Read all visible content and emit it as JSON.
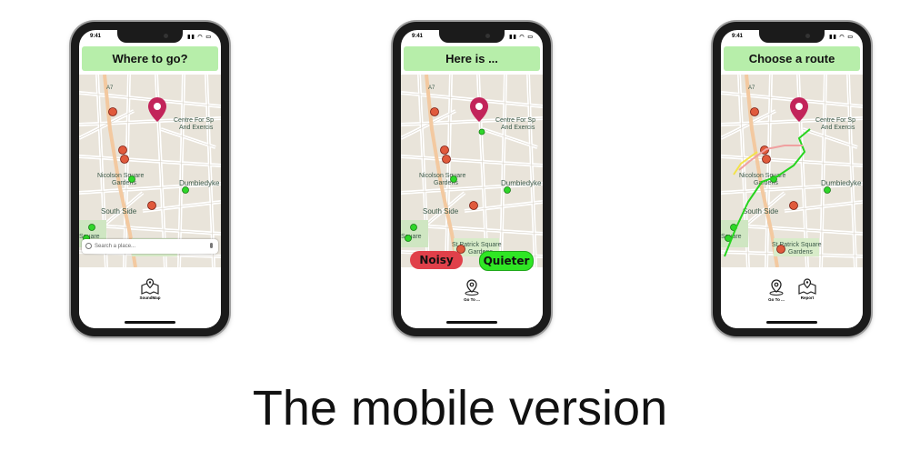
{
  "status": {
    "time": "9:41",
    "signal": "▮▮ ◠ ▭"
  },
  "phones": [
    {
      "title": "Where to go?",
      "search_placeholder": "Search a place...",
      "nav": [
        {
          "label": "SoundMap",
          "icon": "map-pin-icon"
        }
      ]
    },
    {
      "title": "Here is ...",
      "buttons": {
        "noisy": "Noisy",
        "quieter": "Quieter"
      },
      "nav": [
        {
          "label": "Go To ...",
          "icon": "location-pin-icon"
        }
      ]
    },
    {
      "title": "Choose a route",
      "nav": [
        {
          "label": "Go To ...",
          "icon": "location-pin-icon"
        },
        {
          "label": "Report",
          "icon": "map-pin-icon"
        }
      ]
    }
  ],
  "map_labels": {
    "centre": "Centre For Sp",
    "centre2": "And Exercis",
    "nicolson": "Nicolson Square",
    "gardens": "Gardens",
    "dumbiedykes": "Dumbiedyke",
    "southside": "South Side",
    "stpatrick": "St Patrick Square",
    "gardens2": "Gardens",
    "square": "Square",
    "a7": "A7"
  },
  "colors": {
    "header": "#b7eeaa",
    "noisy": "#e0404a",
    "quieter": "#2fe624",
    "pin": "#c2245a"
  },
  "caption": "The mobile version"
}
